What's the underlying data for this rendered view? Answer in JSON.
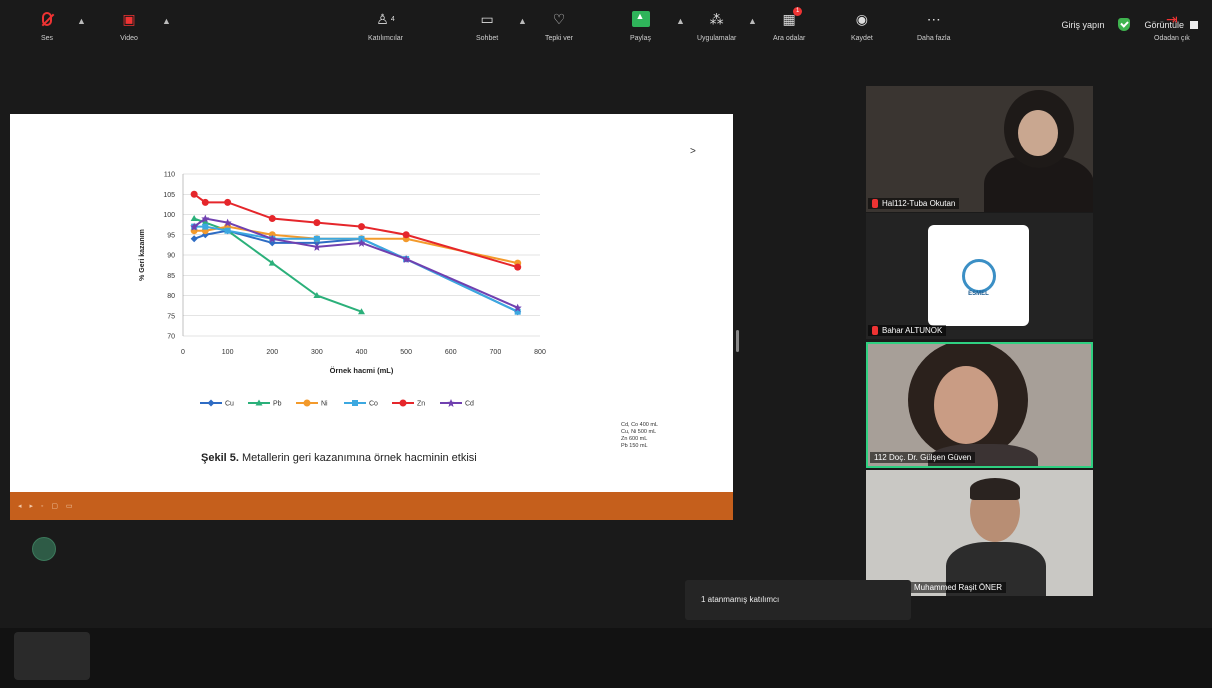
{
  "topbar": {
    "signin_label": "Giriş yapın",
    "view_label": "Görüntüle",
    "shield_color": "#3fb34f"
  },
  "slide": {
    "caption_bold": "Şekil 5.",
    "caption_rest": " Metallerin geri kazanımına örnek hacminin etkisi",
    "next_arrow": ">",
    "notes": [
      "Cd, Co 400 mL",
      "Cu, Ni 500 mL",
      "Zn 600 mL",
      "Pb 150 mL"
    ],
    "footer_colors": "#c55f1c"
  },
  "chart_data": {
    "type": "line",
    "xlabel": "Örnek hacmi (mL)",
    "ylabel": "% Geri kazanım",
    "xlim": [
      0,
      800
    ],
    "ylim": [
      70,
      110
    ],
    "xticks": [
      0,
      100,
      200,
      300,
      400,
      500,
      600,
      700,
      800
    ],
    "yticks": [
      70,
      75,
      80,
      85,
      90,
      95,
      100,
      105,
      110
    ],
    "grid": true,
    "legend_placement": "bottom",
    "series": [
      {
        "name": "Cu",
        "color": "#2e6cc4",
        "marker": "diamond",
        "x": [
          25,
          50,
          100,
          200,
          300,
          400,
          500,
          750
        ],
        "y": [
          94,
          95,
          96,
          93,
          93,
          94,
          89,
          76
        ]
      },
      {
        "name": "Pb",
        "color": "#2bb07a",
        "marker": "triangle",
        "x": [
          25,
          50,
          100,
          200,
          300,
          400
        ],
        "y": [
          99,
          98,
          96,
          88,
          80,
          76
        ]
      },
      {
        "name": "Ni",
        "color": "#f39a2b",
        "marker": "circle",
        "x": [
          25,
          50,
          100,
          200,
          300,
          400,
          500,
          750
        ],
        "y": [
          96,
          96,
          97,
          95,
          94,
          94,
          94,
          88
        ]
      },
      {
        "name": "Co",
        "color": "#3ca8e0",
        "marker": "square",
        "x": [
          25,
          50,
          100,
          200,
          300,
          400,
          500,
          750
        ],
        "y": [
          97,
          97,
          96,
          94,
          94,
          94,
          89,
          76
        ]
      },
      {
        "name": "Zn",
        "color": "#e5262b",
        "marker": "circle",
        "x": [
          25,
          50,
          100,
          200,
          300,
          400,
          500,
          750
        ],
        "y": [
          105,
          103,
          103,
          99,
          98,
          97,
          95,
          87
        ]
      },
      {
        "name": "Cd",
        "color": "#7040b0",
        "marker": "star",
        "x": [
          25,
          50,
          100,
          200,
          300,
          400,
          500,
          750
        ],
        "y": [
          97,
          99,
          98,
          94,
          92,
          93,
          89,
          77
        ]
      }
    ]
  },
  "participants": [
    {
      "name": "Hal112-Tuba Okutan",
      "muted": true
    },
    {
      "name": "Bahar ALTUNOK",
      "muted": true
    },
    {
      "name": "112 Doç. Dr. Gülşen Güven",
      "muted": false,
      "speaking_color": "#2fd081"
    },
    {
      "name": "Muhammed Raşit ÖNER",
      "muted": false
    }
  ],
  "logo": {
    "text": "ESMEL"
  },
  "notification": {
    "text": "1 atanmamış katılımcı"
  },
  "toolbar": {
    "audio": "Ses",
    "video": "Video",
    "participants": "Katılımcılar",
    "participants_count": "4",
    "chat": "Sohbet",
    "react": "Tepki ver",
    "share": "Paylaş",
    "apps": "Uygulamalar",
    "breakout": "Ara odalar",
    "breakout_badge": "1",
    "record": "Kaydet",
    "more": "Daha fazla",
    "leave": "Odadan çık"
  }
}
